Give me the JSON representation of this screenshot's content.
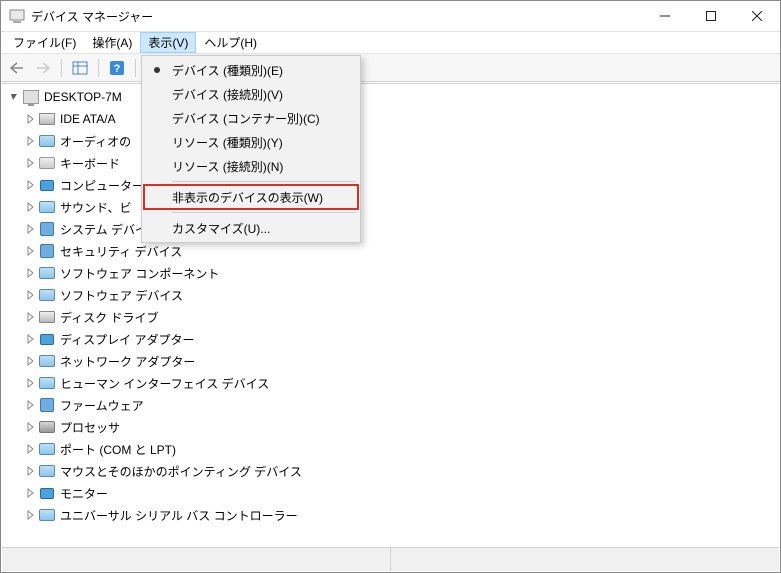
{
  "window": {
    "title": "デバイス マネージャー"
  },
  "menubar": {
    "file": "ファイル(F)",
    "action": "操作(A)",
    "view": "表示(V)",
    "help": "ヘルプ(H)"
  },
  "dropdown": {
    "devices_by_type": "デバイス (種類別)(E)",
    "devices_by_connection": "デバイス (接続別)(V)",
    "devices_by_container": "デバイス (コンテナー別)(C)",
    "resources_by_type": "リソース (種類別)(Y)",
    "resources_by_connection": "リソース (接続別)(N)",
    "show_hidden": "非表示のデバイスの表示(W)",
    "customize": "カスタマイズ(U)..."
  },
  "tree": {
    "root": "DESKTOP-7M",
    "items": [
      "IDE ATA/A",
      "オーディオの",
      "キーボード",
      "コンピューター",
      "サウンド、ビ",
      "システム デバイス",
      "セキュリティ デバイス",
      "ソフトウェア コンポーネント",
      "ソフトウェア デバイス",
      "ディスク ドライブ",
      "ディスプレイ アダプター",
      "ネットワーク アダプター",
      "ヒューマン インターフェイス デバイス",
      "ファームウェア",
      "プロセッサ",
      "ポート (COM と LPT)",
      "マウスとそのほかのポインティング デバイス",
      "モニター",
      "ユニバーサル シリアル バス コントローラー"
    ]
  }
}
